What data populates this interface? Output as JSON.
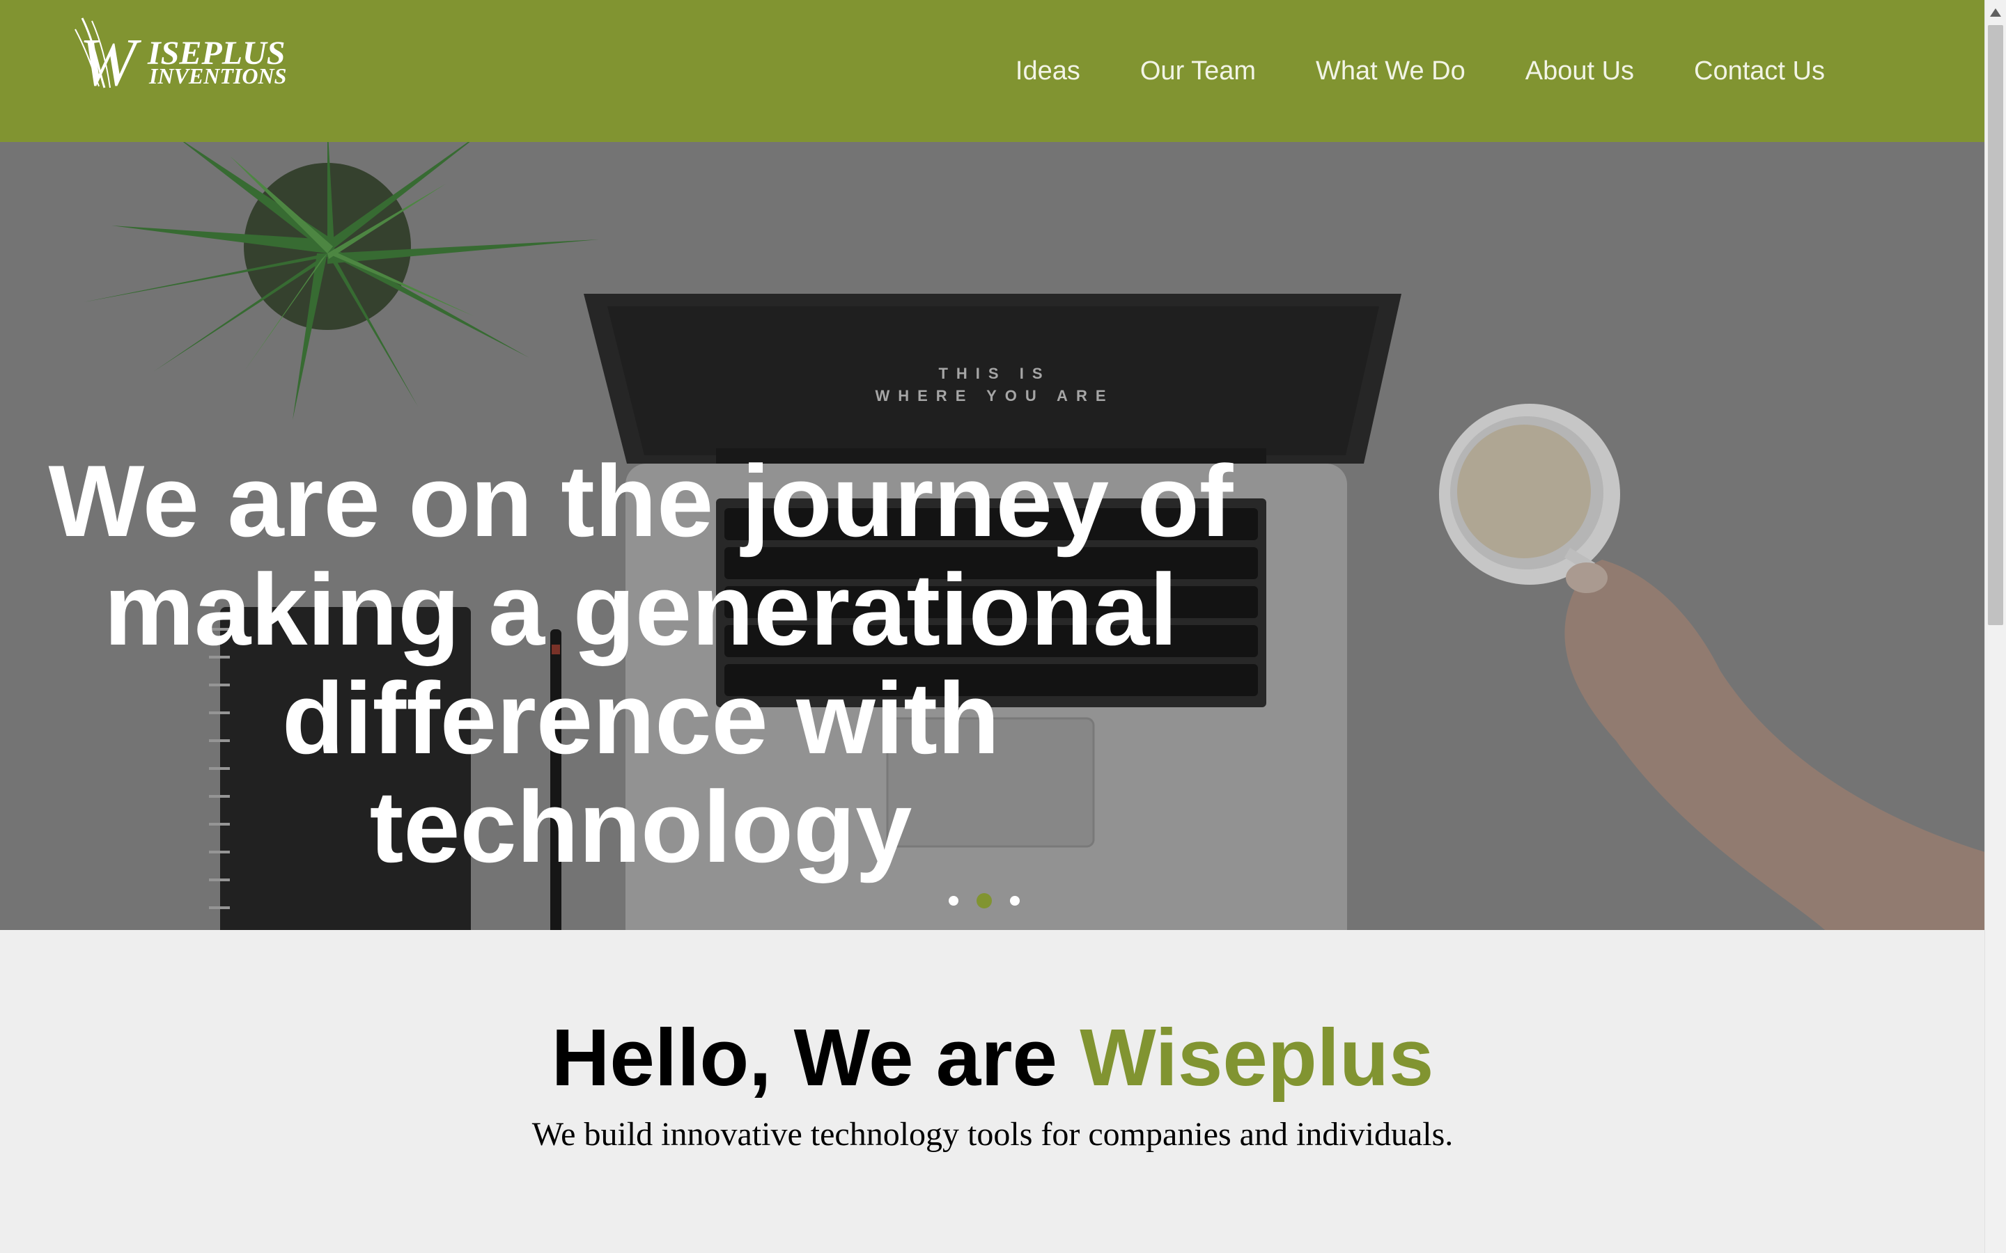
{
  "header": {
    "logo": {
      "line1": "ISEPLUS",
      "line2": "INVENTIONS",
      "monogram": "W"
    },
    "nav": [
      "Ideas",
      "Our Team",
      "What We Do",
      "About Us",
      "Contact Us"
    ]
  },
  "hero": {
    "headline": "We are on the journey of making a generational difference with technology",
    "laptop_screen": {
      "line1": "THIS IS",
      "line2": "WHERE YOU ARE"
    },
    "slides": {
      "count": 3,
      "active": 2
    }
  },
  "intro": {
    "title_prefix": "Hello, We are ",
    "title_brand": "Wiseplus",
    "subtitle": "We build innovative technology tools for companies and individuals."
  },
  "colors": {
    "brand": "#819431",
    "hero_overlay": "#858585",
    "page_bg": "#eeeeee"
  }
}
